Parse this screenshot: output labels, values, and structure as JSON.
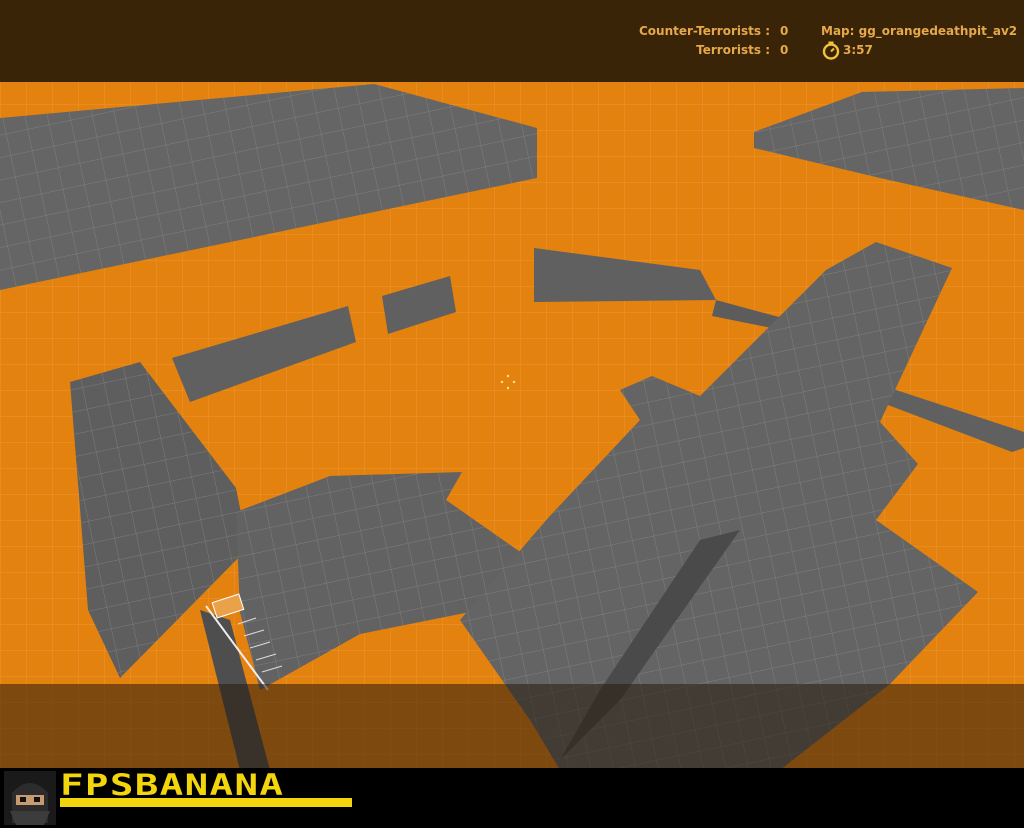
{
  "hud": {
    "ct_label": "Counter-Terrorists :",
    "ct_score": "0",
    "t_label": "Terrorists :",
    "t_score": "0",
    "map_label": "Map: gg_orangedeathpit_av2",
    "timer": "3:57",
    "timer_icon": "stopwatch-icon"
  },
  "branding": {
    "logo_text": "FPSBANANA",
    "avatar_icon": "ninja-avatar-icon"
  },
  "colors": {
    "wall_orange": "#e4820f",
    "block_gray": "#666666",
    "hud_text": "#e5a84a",
    "hud_bar": "#3a2408",
    "brand_yellow": "#f2d50a"
  }
}
